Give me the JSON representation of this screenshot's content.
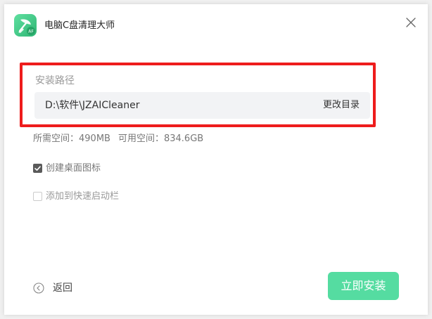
{
  "app": {
    "title": "电脑C盘清理大师",
    "logo_icon": "broom-leaf-icon",
    "logo_badge": "AF"
  },
  "install": {
    "section_label": "安装路径",
    "path_value": "D:\\软件\\JZAICleaner",
    "change_dir_label": "更改目录"
  },
  "space": {
    "required_label": "所需空间：",
    "required_value": "490MB",
    "available_label": "可用空间：",
    "available_value": "834.6GB"
  },
  "options": [
    {
      "label": "创建桌面图标",
      "checked": true
    },
    {
      "label": "添加到快速启动栏",
      "checked": false
    }
  ],
  "footer": {
    "back_label": "返回",
    "install_label": "立即安装"
  },
  "colors": {
    "accent": "#55dca1",
    "highlight_border": "#ee1c1c",
    "logo_gradient_start": "#5fe0a0",
    "logo_gradient_end": "#2fb574"
  }
}
